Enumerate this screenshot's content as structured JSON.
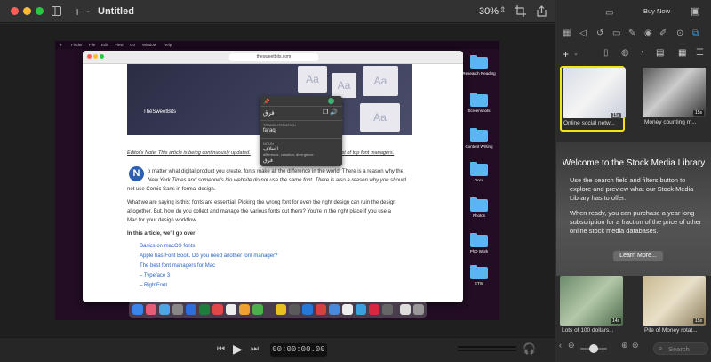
{
  "window": {
    "title": "Untitled",
    "zoom": "30%",
    "buy_now": "Buy Now"
  },
  "canvas": {
    "menubar": {
      "items": [
        "Finder",
        "File",
        "Edit",
        "View",
        "Go",
        "Window",
        "Help"
      ]
    },
    "browser": {
      "url": "thesweetbits.com",
      "hero_brand": "TheSweetBits",
      "note": "Editor's Note: This article is being continuously updated.",
      "note_link": "list of top font managers.",
      "dropcap": "N",
      "para1_line1": "o matter what digital product you create, fonts make all the difference in the world. There is a reason why the",
      "para1_line2": "New York Times and someone's bio website do not use the same font. There is also a reason why you should",
      "para1_line3": "not use Comic Sans in formal design.",
      "para2_line1": "What we are saying is this: fonts are essential. Picking the wrong font for even the right design can ruin the design",
      "para2_line2": "altogether. But, how do you collect and manage the various fonts out there? You're in the right place if you use a",
      "para2_line3": "Mac for your design workflow.",
      "list_heading": "In this article, we'll go over:",
      "links": [
        "Basics on macOS fonts",
        "Apple has Font Book. Do you need another font manager?",
        "The best font managers for Mac",
        "– Typeface 3",
        "– RightFont"
      ]
    },
    "popup": {
      "word": "فرق",
      "transliteration_label": "TRANSLITERATION",
      "transliteration": "faraq",
      "noun_label": "NOUN",
      "noun1": "اختلاف",
      "noun1_meaning": "difference, variation, divergence",
      "noun2": "فرق"
    },
    "folders": [
      "Research Reading",
      "Screenshots",
      "Content Writing",
      "Docs",
      "Photos",
      "PhD Work",
      "ETW"
    ]
  },
  "player": {
    "timecode": "00:00:00.00"
  },
  "library": {
    "items": [
      {
        "label": "Online social netw...",
        "duration": "15s"
      },
      {
        "label": "Money counting m...",
        "duration": "15s"
      },
      {
        "label": "Lots of 100 dollars...",
        "duration": "14s"
      },
      {
        "label": "Pile of Money rotat...",
        "duration": "15s"
      }
    ],
    "welcome": {
      "title": "Welcome to the Stock Media Library",
      "p1": "Use the search field and filters button to explore and preview what our Stock Media Library has to offer.",
      "p2": "When ready, you can purchase a year long subscription for a fraction of the price of other online stock media databases.",
      "button": "Learn More..."
    },
    "search_placeholder": "Search"
  },
  "colors": {
    "selection": "#f5e21a",
    "accent_link": "#2563c9",
    "folder": "#5ab6f3"
  }
}
